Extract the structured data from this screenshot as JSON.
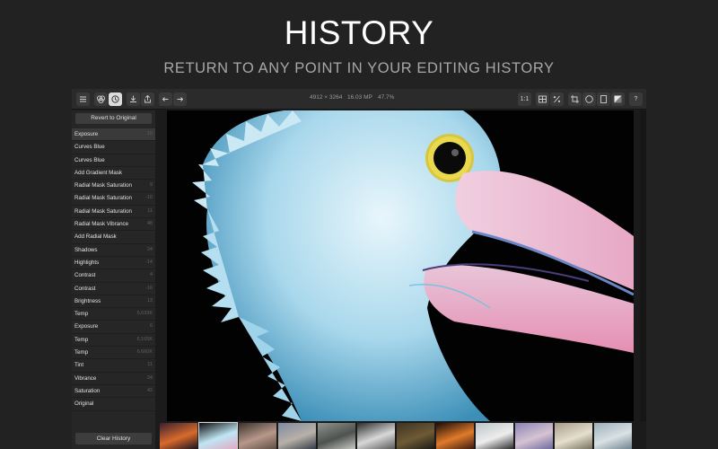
{
  "hero": {
    "title": "HISTORY",
    "subtitle": "RETURN TO ANY POINT IN YOUR EDITING HISTORY"
  },
  "toolbar": {
    "image_size": "4912 × 3264",
    "megapixels": "16.03 MP",
    "zoom": "47.7%",
    "zoom_1to1_label": "1:1",
    "help_label": "?"
  },
  "sidebar": {
    "revert_label": "Revert to Original",
    "clear_label": "Clear History",
    "history": [
      {
        "label": "Exposure",
        "value": "10",
        "selected": true
      },
      {
        "label": "Curves Blue",
        "value": ""
      },
      {
        "label": "Curves Blue",
        "value": ""
      },
      {
        "label": "Add Gradient Mask",
        "value": ""
      },
      {
        "label": "Radial Mask Saturation",
        "value": "9"
      },
      {
        "label": "Radial Mask Saturation",
        "value": "-10"
      },
      {
        "label": "Radial Mask Saturation",
        "value": "11"
      },
      {
        "label": "Radial Mask Vibrance",
        "value": "48"
      },
      {
        "label": "Add Radial Mask",
        "value": ""
      },
      {
        "label": "Shadows",
        "value": "24"
      },
      {
        "label": "Highlights",
        "value": "-14"
      },
      {
        "label": "Contrast",
        "value": "4"
      },
      {
        "label": "Contrast",
        "value": "-16"
      },
      {
        "label": "Brightness",
        "value": "13"
      },
      {
        "label": "Temp",
        "value": "6,633K"
      },
      {
        "label": "Exposure",
        "value": "6"
      },
      {
        "label": "Temp",
        "value": "6,165K"
      },
      {
        "label": "Temp",
        "value": "6,660K"
      },
      {
        "label": "Tint",
        "value": "11"
      },
      {
        "label": "Vibrance",
        "value": "24"
      },
      {
        "label": "Saturation",
        "value": "42"
      },
      {
        "label": "Original",
        "value": ""
      }
    ]
  },
  "filmstrip": {
    "thumbnails": [
      {
        "name": "sunset",
        "c1": "#3a2030",
        "c2": "#d86a2c",
        "c3": "#1a1320"
      },
      {
        "name": "pelican",
        "c1": "#0b0b0b",
        "c2": "#bfe6f4",
        "c3": "#e2a9c4",
        "selected": true
      },
      {
        "name": "portrait",
        "c1": "#3b332d",
        "c2": "#b7988a",
        "c3": "#5e4d44"
      },
      {
        "name": "beach",
        "c1": "#7e8aa0",
        "c2": "#b8b1a8",
        "c3": "#353b46"
      },
      {
        "name": "fog-figure",
        "c1": "#8f948e",
        "c2": "#4f534f",
        "c3": "#c7c9c4"
      },
      {
        "name": "waterfall",
        "c1": "#2c2c2c",
        "c2": "#d8d8d8",
        "c3": "#5a5a5a"
      },
      {
        "name": "forest",
        "c1": "#3e3325",
        "c2": "#6e5a35",
        "c3": "#1b1a14"
      },
      {
        "name": "fireworks",
        "c1": "#1a0d07",
        "c2": "#e07a2a",
        "c3": "#3a1b10"
      },
      {
        "name": "building",
        "c1": "#bcc4c8",
        "c2": "#ededed",
        "c3": "#2c2c2c"
      },
      {
        "name": "cloudy-sky",
        "c1": "#8b83b6",
        "c2": "#d6c3d2",
        "c3": "#6e6a9c"
      },
      {
        "name": "dunes",
        "c1": "#a79c88",
        "c2": "#e6dfce",
        "c3": "#76705f"
      },
      {
        "name": "seascape",
        "c1": "#9eb0bb",
        "c2": "#d9e1e4",
        "c3": "#6f8490"
      }
    ]
  }
}
